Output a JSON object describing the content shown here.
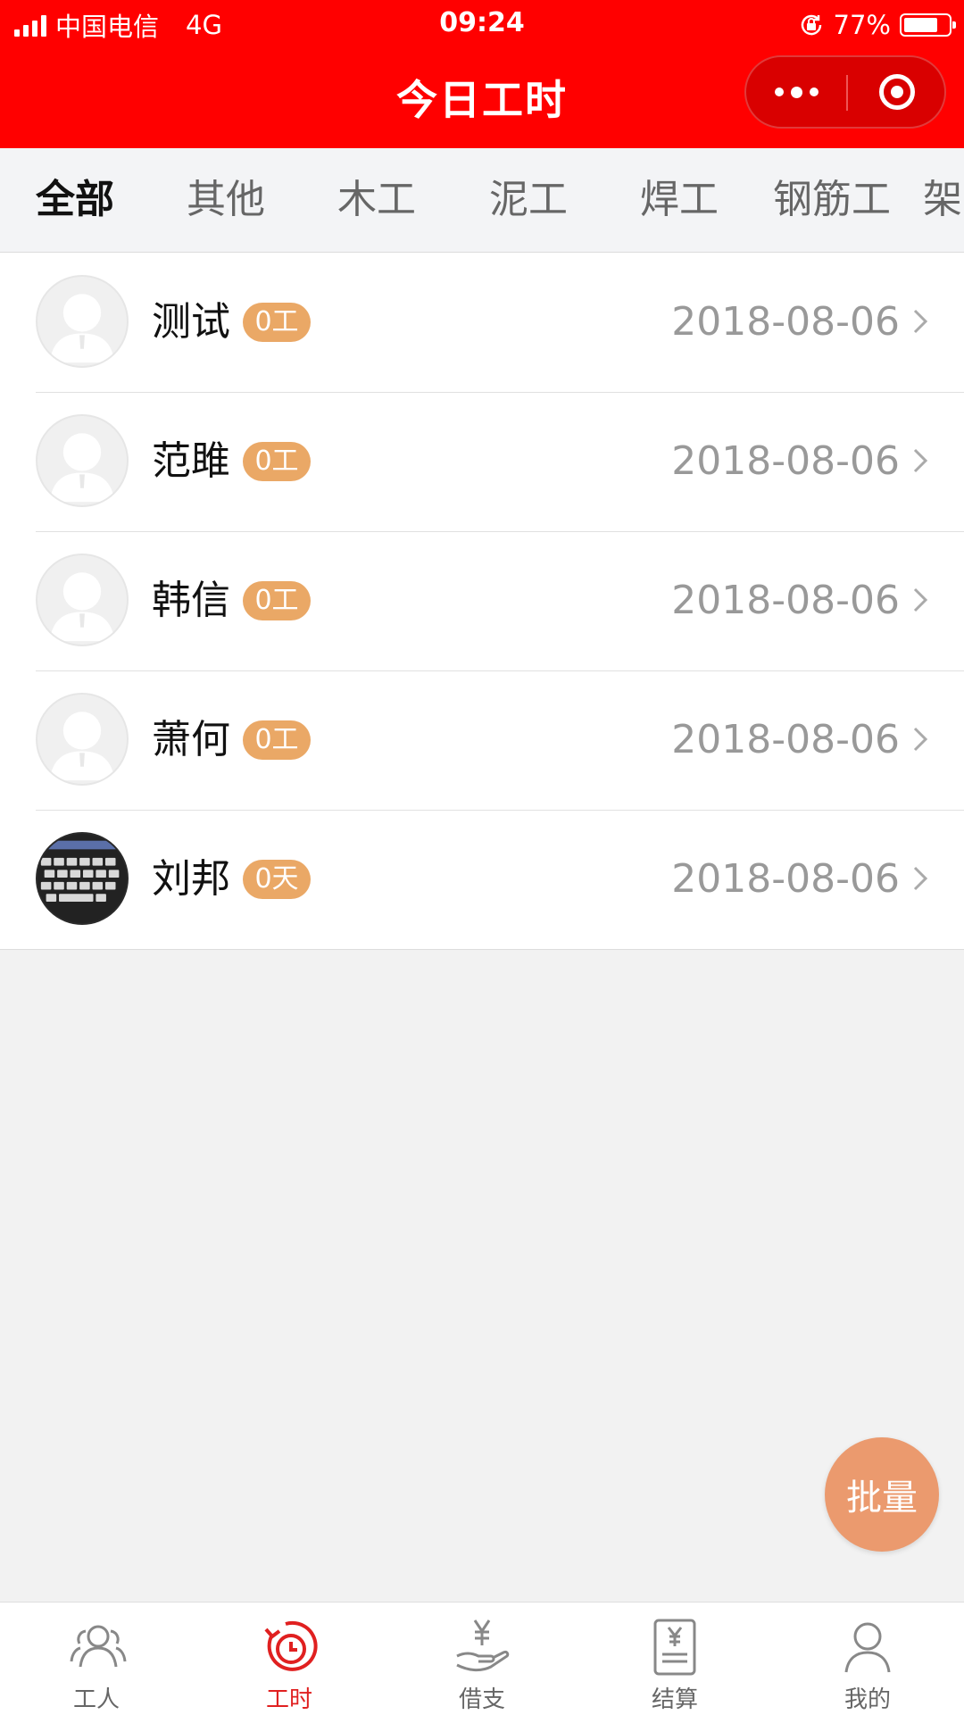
{
  "status_bar": {
    "carrier": "中国电信",
    "network": "4G",
    "time": "09:24",
    "battery": "77%",
    "battery_level": 0.77
  },
  "header": {
    "title": "今日工时",
    "capsule": {
      "more_icon": "more-dots-icon",
      "close_icon": "target-circle-icon"
    },
    "color": "#ff0000"
  },
  "category_tabs": [
    {
      "label": "全部",
      "active": true
    },
    {
      "label": "其他"
    },
    {
      "label": "木工"
    },
    {
      "label": "泥工"
    },
    {
      "label": "焊工"
    },
    {
      "label": "钢筋工"
    },
    {
      "label": "架"
    }
  ],
  "workers": [
    {
      "name": "测试",
      "hours": "0工",
      "date": "2018-08-06",
      "avatar": "default-avatar"
    },
    {
      "name": "范雎",
      "hours": "0工",
      "date": "2018-08-06",
      "avatar": "default-avatar"
    },
    {
      "name": "韩信",
      "hours": "0工",
      "date": "2018-08-06",
      "avatar": "default-avatar"
    },
    {
      "name": "萧何",
      "hours": "0工",
      "date": "2018-08-06",
      "avatar": "default-avatar"
    },
    {
      "name": "刘邦",
      "hours": "0天",
      "date": "2018-08-06",
      "avatar": "keyboard-photo"
    }
  ],
  "fab": {
    "label": "批量",
    "color": "#eb9a6e"
  },
  "bottom_nav": [
    {
      "label": "工人",
      "icon": "people-icon"
    },
    {
      "label": "工时",
      "icon": "clock-icon",
      "active": true
    },
    {
      "label": "借支",
      "icon": "yen-hand-icon"
    },
    {
      "label": "结算",
      "icon": "yen-document-icon"
    },
    {
      "label": "我的",
      "icon": "person-icon"
    }
  ],
  "colors": {
    "accent": "#e02020",
    "badge": "#eaa866"
  }
}
